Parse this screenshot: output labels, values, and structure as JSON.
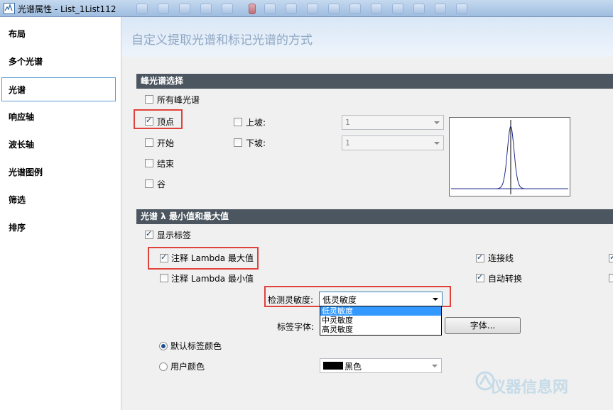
{
  "window": {
    "title": "光谱属性 - List_1List112"
  },
  "sidebar": {
    "items": [
      {
        "label": "布局"
      },
      {
        "label": "多个光谱"
      },
      {
        "label": "光谱"
      },
      {
        "label": "响应轴"
      },
      {
        "label": "波长轴"
      },
      {
        "label": "光谱图例"
      },
      {
        "label": "筛选"
      },
      {
        "label": "排序"
      }
    ],
    "active_index": 2
  },
  "header": {
    "title": "自定义提取光谱和标记光谱的方式"
  },
  "peak_section": {
    "title": "峰光谱选择",
    "all_peaks": {
      "label": "所有峰光谱",
      "checked": false
    },
    "apex": {
      "label": "顶点",
      "checked": true
    },
    "start": {
      "label": "开始",
      "checked": false
    },
    "end": {
      "label": "结束",
      "checked": false
    },
    "valley": {
      "label": "谷",
      "checked": false
    },
    "upslope": {
      "label": "上坡:",
      "checked": false,
      "value": "1"
    },
    "downslope": {
      "label": "下坡:",
      "checked": false,
      "value": "1"
    }
  },
  "lambda_section": {
    "title": "光谱 λ 最小值和最大值",
    "show_labels": {
      "label": "显示标签",
      "checked": true
    },
    "annotate_max": {
      "label": "注释 Lambda 最大值",
      "checked": true
    },
    "annotate_min": {
      "label": "注释 Lambda 最小值",
      "checked": false
    },
    "connect_line": {
      "label": "连接线",
      "checked": true
    },
    "auto_rotate": {
      "label": "自动转换",
      "checked": true
    },
    "sensitivity": {
      "label": "检测灵敏度:",
      "value": "低灵敏度",
      "options": [
        "低灵敏度",
        "中灵敏度",
        "高灵敏度"
      ],
      "highlighted_index": 0
    },
    "label_font": {
      "label": "标签字体:",
      "button": "字体..."
    },
    "default_color": {
      "label": "默认标签颜色",
      "selected": true
    },
    "user_color": {
      "label": "用户颜色",
      "selected": false,
      "value": "黑色",
      "swatch": "#000000"
    }
  },
  "watermark": {
    "text": "仪器信息网"
  }
}
